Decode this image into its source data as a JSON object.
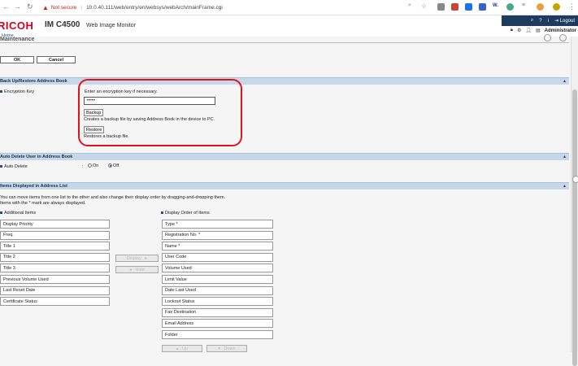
{
  "browser": {
    "security_label": "Not secure",
    "url": "10.0.40.111/web/entry/en/websys/webArch/mainFrame.cgi"
  },
  "header": {
    "logo": "RICOH",
    "model": "IM C4500",
    "app_name": "Web Image Monitor",
    "logout_label": "Logout",
    "user_label": "Administrator"
  },
  "breadcrumb": "Home",
  "page_title": "Maintenance",
  "actions": {
    "ok_label": "OK",
    "cancel_label": "Cancel"
  },
  "backup_section": {
    "title": "Back Up/Restore Address Book",
    "encryption_label": "Encryption Key",
    "encryption_hint": "Enter an encryption key if necessary.",
    "encryption_value": "••••",
    "backup_button": "Backup",
    "backup_desc": "Creates a backup file by saving Address Book in the device to PC.",
    "restore_button": "Restore",
    "restore_desc": "Restores a backup file."
  },
  "auto_delete_section": {
    "title": "Auto Delete User in Address Book",
    "label": "Auto Delete",
    "separator": ":",
    "on_label": "On",
    "off_label": "Off",
    "selected": "Off"
  },
  "items_section": {
    "title": "Items Displayed in Address List",
    "desc_line1": "You can move items from one list to the other and also change their display order by dragging-and-dropping them.",
    "desc_line2": "Items with the * mark are always displayed.",
    "additional_label": "Additional Items",
    "display_order_label": "Display Order of Items",
    "additional_items": [
      "Display Priority",
      "Freq.",
      "Title 1",
      "Title 2",
      "Title 3",
      "Previous Volume Used",
      "Last Reset Date",
      "Certificate Status"
    ],
    "display_items": [
      "Type *",
      "Registration No. *",
      "Name *",
      "User Code",
      "Volume Used",
      "Limit Value",
      "Date Last Used",
      "Lockout Status",
      "Fax Destination",
      "Email Address",
      "Folder"
    ],
    "display_button": "Display",
    "hide_button": "Hide",
    "up_button": "Up",
    "down_button": "Down"
  }
}
